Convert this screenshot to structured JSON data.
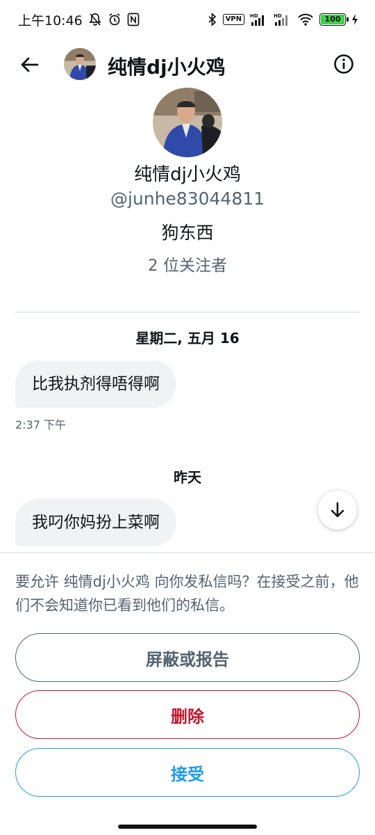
{
  "status_bar": {
    "time": "上午10:46",
    "vpn": "VPN",
    "hd1": "HD",
    "hd2": "HD",
    "battery": "100",
    "battery_level": 1.0
  },
  "header": {
    "title": "纯情dj小火鸡"
  },
  "profile": {
    "name": "纯情dj小火鸡",
    "handle": "@junhe83044811",
    "bio": "狗东西",
    "followers": "2 位关注者"
  },
  "conversation": [
    {
      "date": "星期二, 五月 16",
      "message": "比我执剂得唔得啊",
      "time": "2:37 下午"
    },
    {
      "date": "昨天",
      "message": "我叼你妈扮上菜啊"
    }
  ],
  "request": {
    "text": "要允许 纯情dj小火鸡 向你发私信吗？在接受之前，他们不会知道你已看到他们的私信。",
    "block_label": "屏蔽或报告",
    "delete_label": "删除",
    "accept_label": "接受"
  },
  "colors": {
    "accent": "#1d9bf0",
    "danger": "#c4152d",
    "secondary_text": "#536471",
    "bubble": "#eff3f4"
  }
}
